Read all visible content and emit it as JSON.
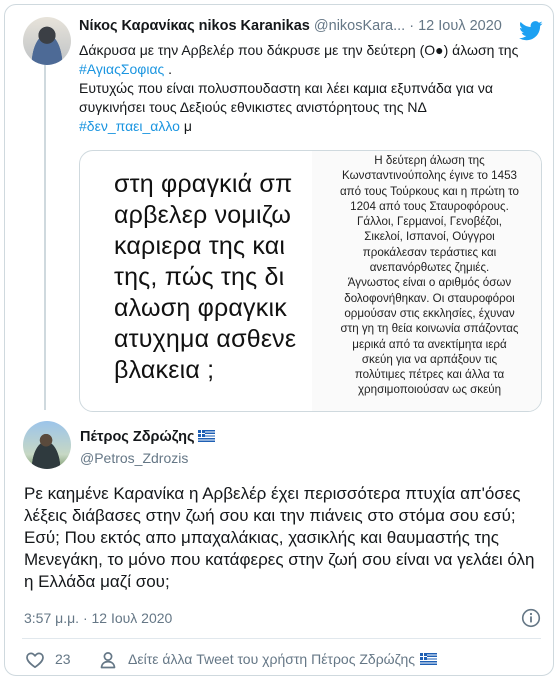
{
  "parent_tweet": {
    "name": "Νίκος Καρανίκας nikos Karanikas",
    "handle": "@nikosKara...",
    "separator": "·",
    "date": "12 Ιουλ 2020",
    "text_line1": "Δάκρυσα με την Αρβελέρ που δάκρυσε με την δεύτερη (O●) άλωση της",
    "hashtag1": "#ΑγιαςΣοφιας",
    "text_after_hashtag1": " .",
    "text_line2": "Ευτυχώς που είναι πολυσπουδαστη και λέει καμια εξυπνάδα για να συγκινήσει τους Δεξιούς εθνικιστες ανιστόρητους της ΝΔ",
    "hashtag2": "#δεν_παει_αλλο",
    "text_after_hashtag2": "  μ",
    "media_left_lines": [
      "στη φραγκιά σπ",
      "αρβελερ νομιζω",
      "καριερα της και",
      "της, πώς της δι",
      "αλωση φραγκικ",
      "ατυχημα ασθενε",
      "βλακεια ;"
    ],
    "media_right_lines": [
      "Η δεύτερη άλωση της",
      "Κωνσταντινούπολης έγινε το 1453",
      "από τους Τούρκους και η πρώτη το",
      "1204 από τους Σταυροφόρους.",
      "Γάλλοι, Γερμανοί, Γενοβέζοι,",
      "Σικελοί, Ισπανοί, Ούγγροι",
      "προκάλεσαν τεράστιες και",
      "ανεπανόρθωτες ζημιές.",
      "Άγνωστος είναι ο αριθμός όσων",
      "δολοφονήθηκαν. Οι σταυροφόροι",
      "ορμούσαν στις εκκλησίες, έχυναν",
      "στη γη τη θεία κοινωνία σπάζοντας",
      "μερικά από τα ανεκτίμητα ιερά",
      "σκεύη για να αρπάξουν τις",
      "πολύτιμες πέτρες και άλλα τα",
      "χρησιμοποιούσαν ως σκεύη"
    ]
  },
  "reply_tweet": {
    "name": "Πέτρος Ζδρώζης",
    "handle": "@Petros_Zdrozis",
    "text": "Ρε καημένε Καρανίκα η Αρβελέρ έχει περισσότερα πτυχία απ'όσες λέξεις διάβασες στην ζωή σου και την πιάνεις στο στόμα σου εσύ; Εσύ; Που εκτός απο μπαχαλάκιας, χασικλής και θαυμαστής της Μενεγάκη, το μόνο που  κατάφερες στην ζωή σου είναι να γελάει όλη η Ελλάδα μαζί σου;",
    "timestamp": "3:57 μ.μ. · 12 Ιουλ 2020",
    "like_count": "23",
    "see_more_label": "Δείτε άλλα Tweet του χρήστη Πέτρος Ζδρώζης"
  },
  "icons": {
    "brand": "twitter-bird-icon",
    "info": "info-icon",
    "like": "heart-icon",
    "profile": "user-icon",
    "flag": "greece-flag-icon"
  },
  "colors": {
    "accent": "#1da1f2",
    "hashtag": "#1b95e0",
    "muted": "#657786",
    "border": "#cfd9de"
  }
}
